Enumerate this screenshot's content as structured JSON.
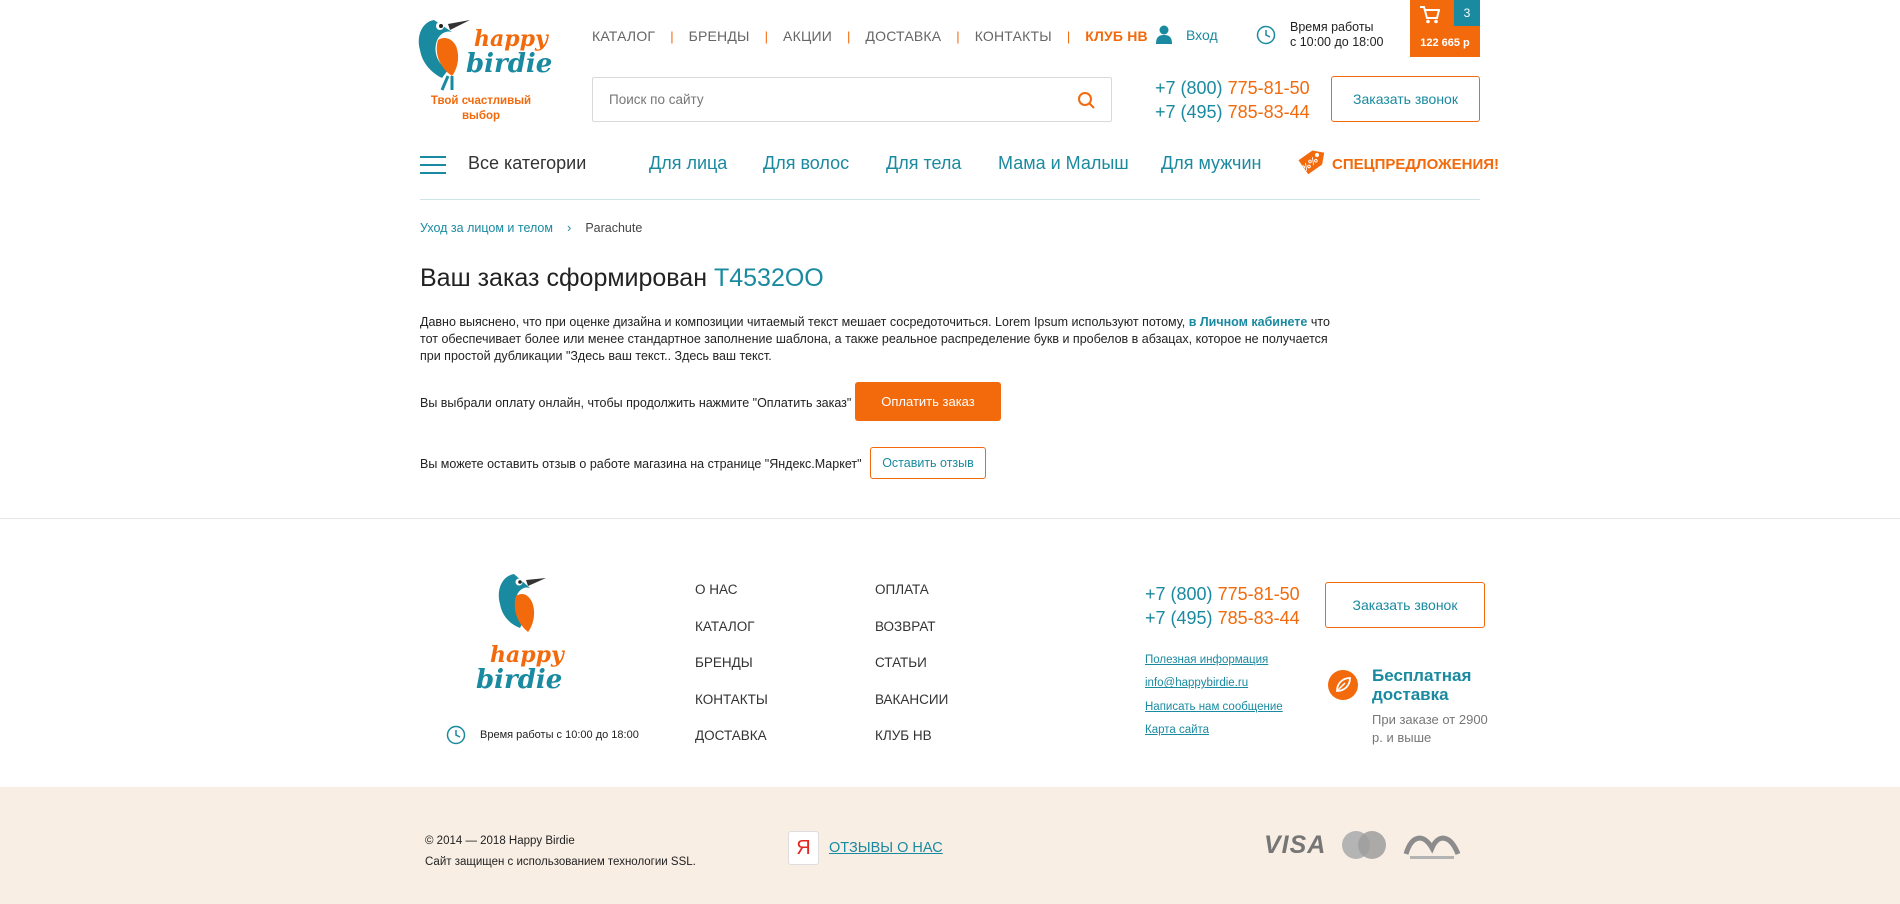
{
  "header": {
    "logo_alt": "Happy Birdie",
    "tagline": "Твой счастливый выбор",
    "nav": [
      {
        "label": "КАТАЛОГ"
      },
      {
        "label": "БРЕНДЫ"
      },
      {
        "label": "АКЦИИ"
      },
      {
        "label": "ДОСТАВКА"
      },
      {
        "label": "КОНТАКТЫ"
      },
      {
        "label": "КЛУБ НВ"
      }
    ],
    "login_label": "Вход",
    "hours_line1": "Время работы",
    "hours_line2": "с 10:00 до 18:00",
    "cart_count": "3",
    "cart_total": "122 665 р",
    "search_placeholder": "Поиск по сайту",
    "phone1_code": "+7 (800)",
    "phone1_num": "775-81-50",
    "phone2_code": "+7 (495)",
    "phone2_num": "785-83-44",
    "callback_label": "Заказать звонок"
  },
  "categories": {
    "all_label": "Все категории",
    "items": [
      {
        "label": "Для лица"
      },
      {
        "label": "Для волос"
      },
      {
        "label": "Для тела"
      },
      {
        "label": "Мама и Малыш"
      },
      {
        "label": "Для мужчин"
      }
    ],
    "special_label": "СПЕЦПРЕДЛОЖЕНИЯ!"
  },
  "breadcrumb": {
    "parent": "Уход за лицом и телом",
    "current": "Parachute"
  },
  "main": {
    "title": "Ваш заказ сформирован",
    "order_number": "T4532OO",
    "para_part1": "Давно выяснено, что при оценке дизайна и композиции читаемый текст мешает сосредоточиться. Lorem Ipsum используют потому,",
    "para_link": "в Личном кабинете",
    "para_part2": "что тот обеспечивает более или менее стандартное заполнение шаблона, а также реальное распределение букв и пробелов в абзацах, которое не получается при простой дубликации \"Здесь ваш текст.. Здесь ваш текст.",
    "pay_text": "Вы выбрали оплату онлайн, чтобы продолжить нажмите \"Оплатить заказ\"",
    "pay_button": "Оплатить заказ",
    "review_text": "Вы можете оставить отзыв о работе магазина на странице \"Яндекс.Маркет\"",
    "review_button": "Оставить отзыв"
  },
  "footer": {
    "hours": "Время работы с 10:00 до 18:00",
    "col1": [
      {
        "label": "О НАС"
      },
      {
        "label": "КАТАЛОГ"
      },
      {
        "label": "БРЕНДЫ"
      },
      {
        "label": "КОНТАКТЫ"
      },
      {
        "label": "ДОСТАВКА"
      }
    ],
    "col2": [
      {
        "label": "ОПЛАТА"
      },
      {
        "label": "ВОЗВРАТ"
      },
      {
        "label": "СТАТЬИ"
      },
      {
        "label": "ВАКАНСИИ"
      },
      {
        "label": "КЛУБ НВ"
      }
    ],
    "phone1_code": "+7 (800)",
    "phone1_num": "775-81-50",
    "phone2_code": "+7 (495)",
    "phone2_num": "785-83-44",
    "callback_label": "Заказать звонок",
    "links": [
      {
        "label": "Полезная информация"
      },
      {
        "label": "info@happybirdie.ru"
      },
      {
        "label": "Написать нам сообщение"
      },
      {
        "label": "Карта сайта"
      }
    ],
    "delivery_title": "Бесплатная доставка",
    "delivery_note": "При заказе от 2900 р. и выше"
  },
  "bottom": {
    "copyright": "© 2014 — 2018 Happy Birdie",
    "ssl": "Сайт защищен с использованием технологии SSL.",
    "yandex_letter": "Я",
    "reviews_link": "ОТЗЫВЫ О НАС",
    "visa": "VISA"
  },
  "colors": {
    "brand_orange": "#f26a0c",
    "brand_teal": "#1a8aa0",
    "bottom_band": "#f8eee4"
  }
}
